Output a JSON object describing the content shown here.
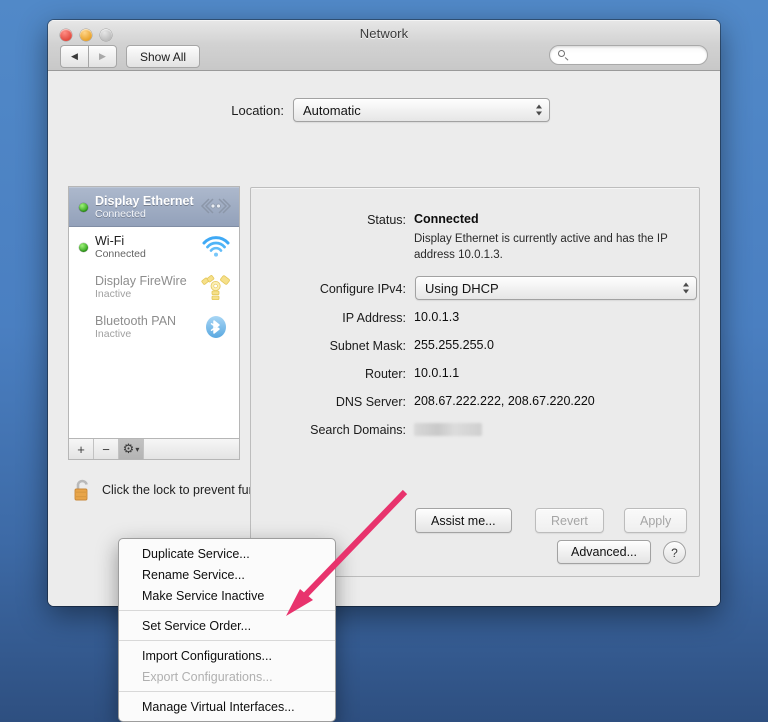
{
  "window": {
    "title": "Network",
    "traffic_lights": [
      "close",
      "minimize",
      "zoom"
    ],
    "toolbar": {
      "back_label": "◀",
      "forward_label": "▶",
      "show_all_label": "Show All",
      "search_placeholder": "",
      "search_value": ""
    }
  },
  "location": {
    "label": "Location:",
    "value": "Automatic"
  },
  "sidebar": {
    "services": [
      {
        "name": "Display Ethernet",
        "status": "Connected",
        "state": "connected",
        "icon": "ethernet-icon",
        "selected": true
      },
      {
        "name": "Wi-Fi",
        "status": "Connected",
        "state": "connected",
        "icon": "wifi-icon",
        "selected": false
      },
      {
        "name": "Display FireWire",
        "status": "Inactive",
        "state": "inactive",
        "icon": "firewire-icon",
        "selected": false
      },
      {
        "name": "Bluetooth PAN",
        "status": "Inactive",
        "state": "inactive",
        "icon": "bluetooth-icon",
        "selected": false
      }
    ],
    "toolbar": {
      "add_label": "+",
      "remove_label": "−",
      "gear_label": "⚙",
      "gear_caret": "▾"
    }
  },
  "lock": {
    "icon": "unlocked-padlock-icon",
    "text": "Click the lock to prevent further changes."
  },
  "detail": {
    "status_label": "Status:",
    "status_value": "Connected",
    "status_description": "Display Ethernet is currently active and has the IP address 10.0.1.3.",
    "configure_ipv4_label": "Configure IPv4:",
    "configure_ipv4_value": "Using DHCP",
    "fields": [
      {
        "label": "IP Address:",
        "value": "10.0.1.3"
      },
      {
        "label": "Subnet Mask:",
        "value": "255.255.255.0"
      },
      {
        "label": "Router:",
        "value": "10.0.1.1"
      },
      {
        "label": "DNS Server:",
        "value": "208.67.222.222, 208.67.220.220"
      }
    ],
    "search_domains_label": "Search Domains:",
    "search_domains_value": "",
    "advanced_label": "Advanced...",
    "help_label": "?"
  },
  "footer": {
    "assist_label": "Assist me...",
    "revert_label": "Revert",
    "apply_label": "Apply"
  },
  "context_menu": {
    "items": [
      {
        "label": "Duplicate Service...",
        "enabled": true
      },
      {
        "label": "Rename Service...",
        "enabled": true
      },
      {
        "label": "Make Service Inactive",
        "enabled": true
      },
      {
        "separator": true
      },
      {
        "label": "Set Service Order...",
        "enabled": true
      },
      {
        "separator": true
      },
      {
        "label": "Import Configurations...",
        "enabled": true
      },
      {
        "label": "Export Configurations...",
        "enabled": false
      },
      {
        "separator": true
      },
      {
        "label": "Manage Virtual Interfaces...",
        "enabled": true
      }
    ]
  },
  "annotation": {
    "arrow_color": "#e8336d",
    "points_to": "Set Service Order..."
  },
  "colors": {
    "desktop": "#4a7fc1",
    "window_bg": "#ececec",
    "selection": "#9aa8bf",
    "status_green": "#31a21a"
  }
}
